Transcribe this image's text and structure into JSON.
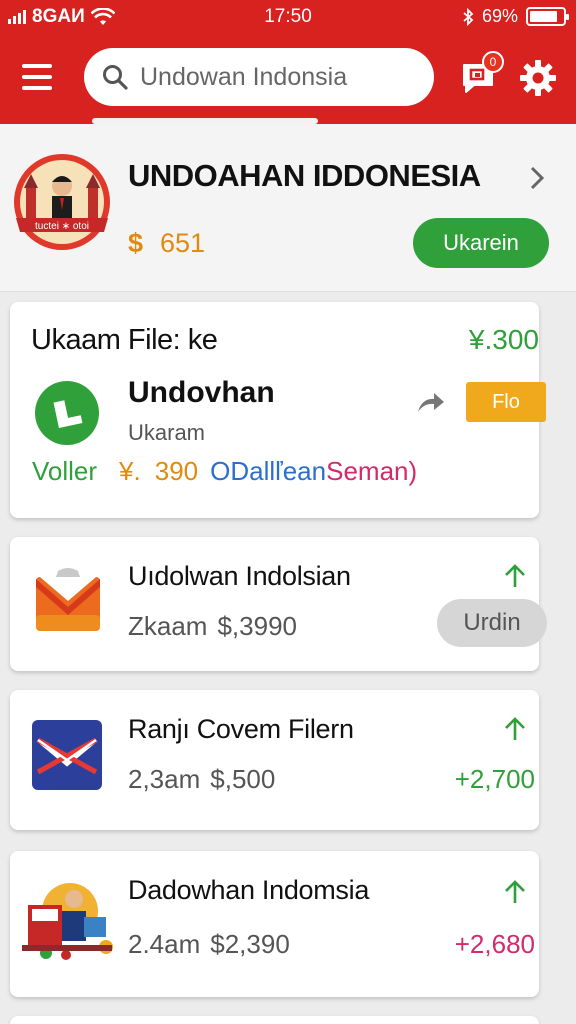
{
  "status_bar": {
    "carrier": "8GAИ",
    "time": "17:50",
    "battery": "69%",
    "battery_level": 0.85
  },
  "header": {
    "search_placeholder": "Undowan Indonsia",
    "notification_count": "0",
    "colors": {
      "brand": "#d8221f"
    }
  },
  "profile": {
    "logo_text": "tuctei ∗ otoi",
    "name": "UNDOAHAN IDDONESIA",
    "coin_symbol": "$",
    "balance": "651",
    "action_label": "Ukarein"
  },
  "featured_card": {
    "heading": "Ukaam File: ke",
    "amount": "¥.300",
    "title": "Undovhan",
    "subtitle": "Ukaram",
    "button_label": "Flo",
    "footer": {
      "status": "Voller",
      "currency": "¥.",
      "value": "390",
      "link_text": "ODallľean",
      "tag": "Seman)"
    }
  },
  "items": [
    {
      "title": "Uıdolwan Indolsian",
      "meta": "Zkaam",
      "price": "$,3990",
      "button_label": "Urdin",
      "icon": "mail-envelope-icon"
    },
    {
      "title": "Ranjı Covem Filern",
      "meta": "2,3am",
      "price": "$,500",
      "amount": "+2,700",
      "icon": "mail-flag-icon"
    },
    {
      "title": "Dadowhan Indomsia",
      "meta": "2.4am",
      "price": "$2,390",
      "amount": "+2,680",
      "icon": "shop-illustration-icon"
    }
  ],
  "colors": {
    "green": "#2fa03a",
    "orange": "#f0a81c",
    "pink": "#d22a6a",
    "blue": "#2a6fd0"
  }
}
